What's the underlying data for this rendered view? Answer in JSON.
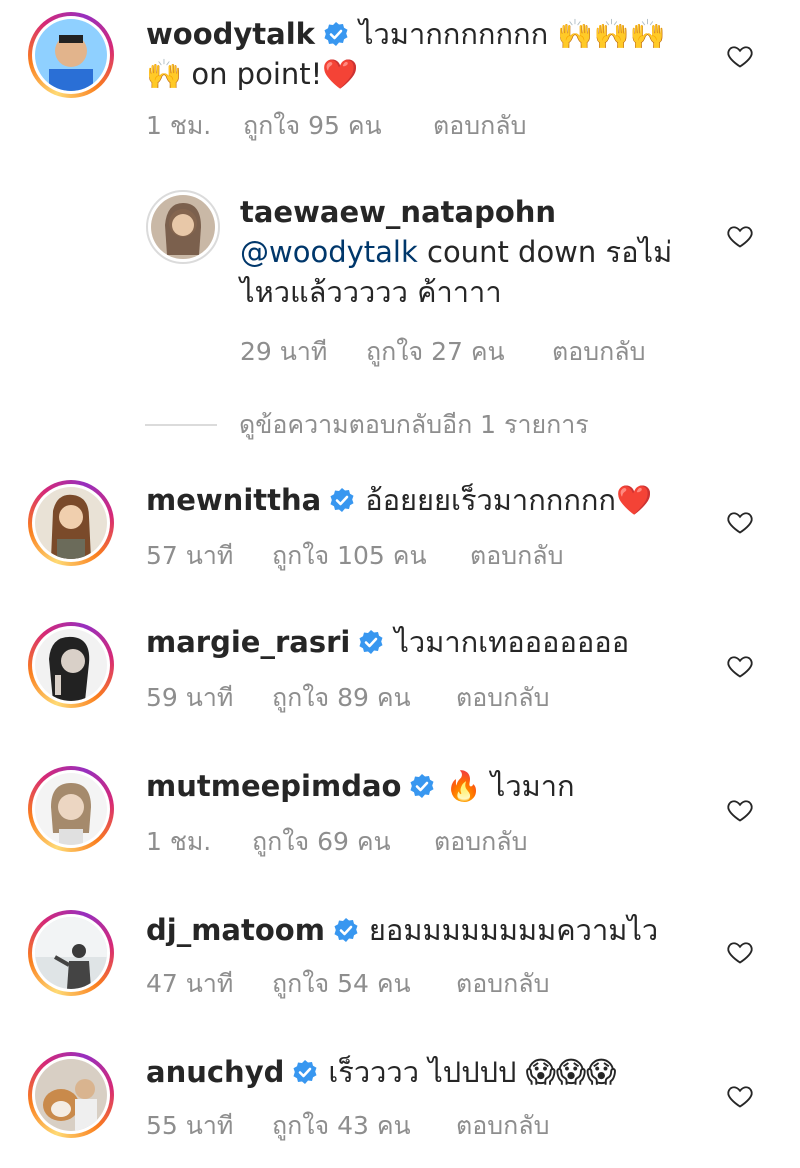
{
  "colors": {
    "ring_start": "#feda75",
    "ring_end": "#962fbf",
    "verified": "#3897f0",
    "heart_red": "#ed2c2c",
    "meta": "#8e8e8e",
    "mention": "#00376b"
  },
  "comments": [
    {
      "username": "woodytalk",
      "verified": true,
      "text_line1": "ไวมากกกกกกก 🙌🙌🙌",
      "text_line2": "🙌 on point!❤️",
      "time": "1 ชม.",
      "likes": "ถูกใจ 95 คน",
      "reply": "ตอบกลับ"
    },
    {
      "username": "taewaew_natapohn",
      "verified": false,
      "mention": "@woodytalk",
      "text_line1": " count down รอไม่",
      "text_line2": "ไหวแล้ววววว ค้าาาา",
      "time": "29 นาที",
      "likes": "ถูกใจ 27 คน",
      "reply": "ตอบกลับ"
    },
    {
      "username": "mewnittha",
      "verified": true,
      "text": "อ้อยยยเร็วมากกกกก❤️",
      "time": "57 นาที",
      "likes": "ถูกใจ 105 คน",
      "reply": "ตอบกลับ"
    },
    {
      "username": "margie_rasri",
      "verified": true,
      "text": "ไวมากเทอออออออ",
      "time": "59 นาที",
      "likes": "ถูกใจ 89 คน",
      "reply": "ตอบกลับ"
    },
    {
      "username": "mutmeepimdao",
      "verified": true,
      "text": "🔥 ไวมาก",
      "time": "1 ชม.",
      "likes": "ถูกใจ 69 คน",
      "reply": "ตอบกลับ"
    },
    {
      "username": "dj_matoom",
      "verified": true,
      "text": "ยอมมมมมมมมความไว",
      "time": "47 นาที",
      "likes": "ถูกใจ 54 คน",
      "reply": "ตอบกลับ"
    },
    {
      "username": "anuchyd",
      "verified": true,
      "text": "เร็วววว ไปปปป 😱😱😱",
      "time": "55 นาที",
      "likes": "ถูกใจ 43 คน",
      "reply": "ตอบกลับ"
    }
  ],
  "view_more_replies": "ดูข้อความตอบกลับอีก 1 รายการ",
  "icons": {
    "like": "heart-outline-icon",
    "verified": "verified-badge-icon"
  }
}
